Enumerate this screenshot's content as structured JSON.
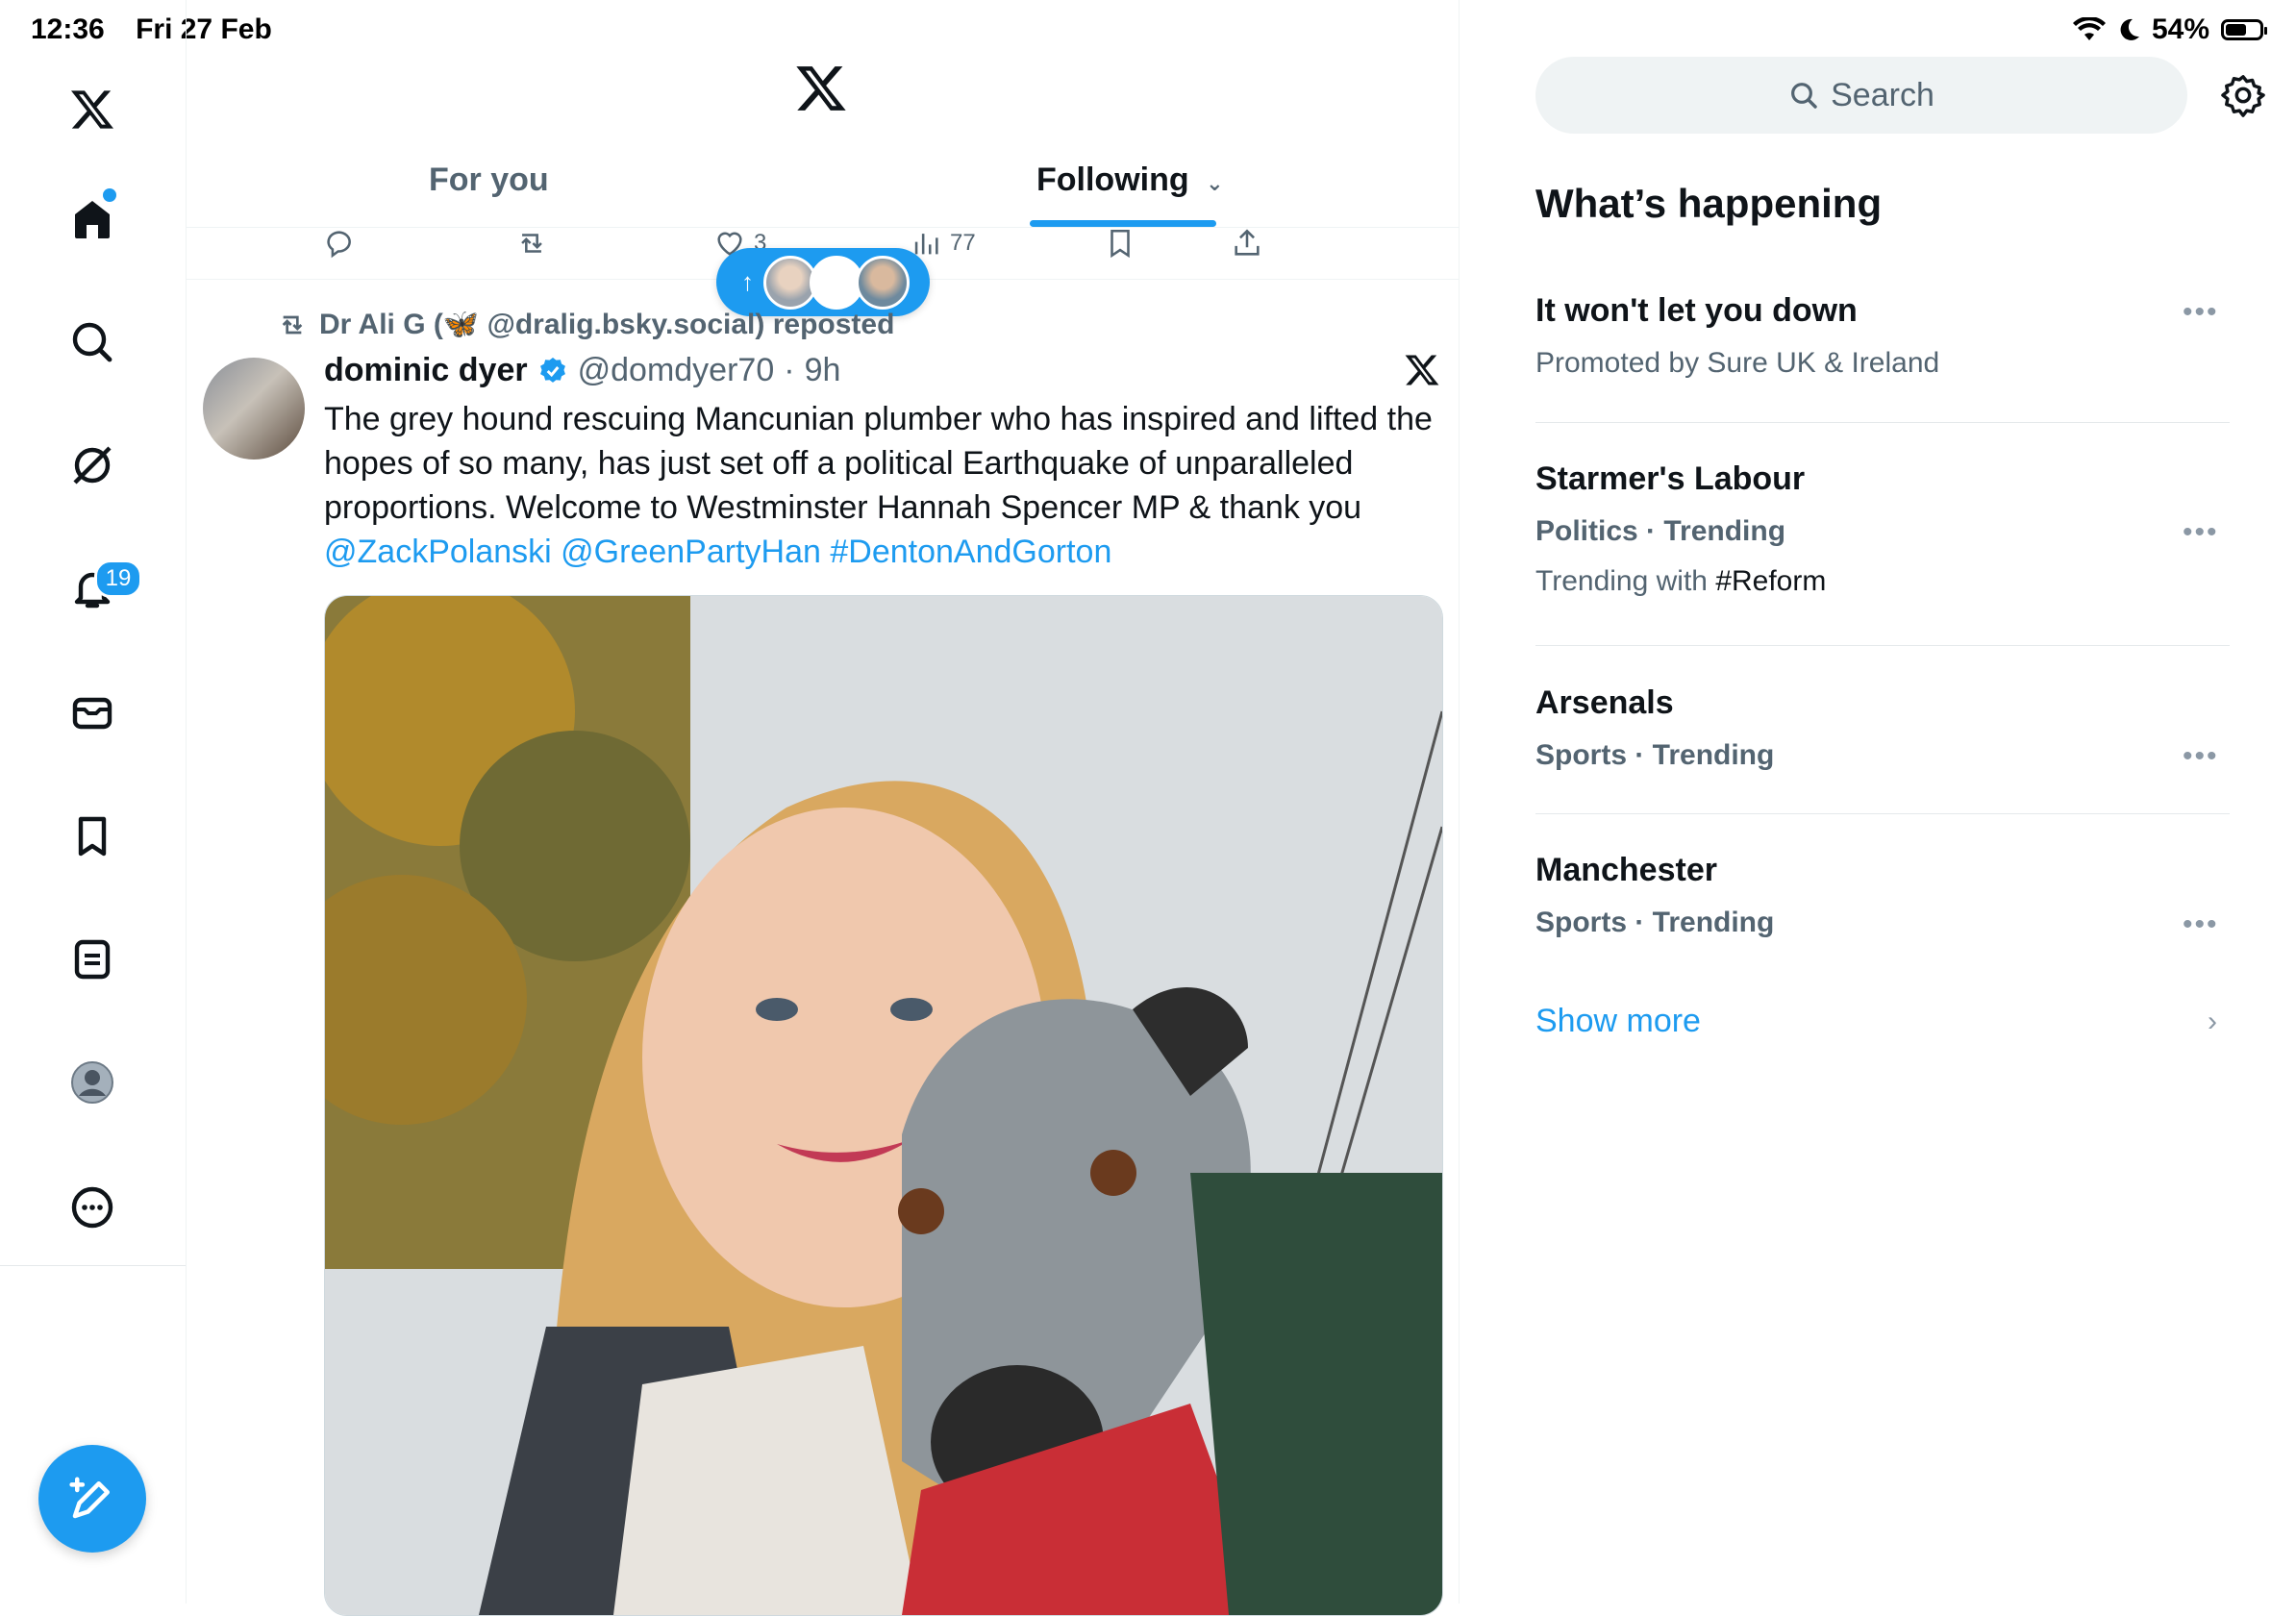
{
  "status_bar": {
    "time": "12:36",
    "date": "Fri 27 Feb",
    "battery": "54%"
  },
  "nav": {
    "items": [
      "home",
      "explore",
      "grok",
      "notifications",
      "messages",
      "bookmarks",
      "lists",
      "profile",
      "more"
    ],
    "notifications_badge": "19"
  },
  "tabs": {
    "for_you": "For you",
    "following": "Following"
  },
  "prev_tweet_actions": {
    "likes": "3",
    "views": "77"
  },
  "tweet": {
    "repost_by": "Dr Ali G (🦋 @dralig.bsky.social) reposted",
    "author_name": "dominic dyer",
    "handle": "@domdyer70",
    "separator": "·",
    "time": "9h",
    "text": "The grey hound rescuing Mancunian plumber who has inspired and lifted the hopes of so many, has just set off a political Earthquake of unparalleled proportions. Welcome to Westminster Hannah Spencer MP & thank you",
    "links": [
      "@ZackPolanski",
      "@GreenPartyHan",
      "#DentonAndGorton"
    ]
  },
  "search": {
    "placeholder": "Search"
  },
  "whats_happening": {
    "title": "What’s happening",
    "trends": [
      {
        "title": "It won't let you down",
        "meta": "Promoted by Sure UK & Ireland"
      },
      {
        "title": "Starmer's Labour",
        "meta": "Politics · Trending",
        "extra_prefix": "Trending with ",
        "extra_tag": "#Reform"
      },
      {
        "title": "Arsenals",
        "meta": "Sports · Trending"
      },
      {
        "title": "Manchester",
        "meta": "Sports · Trending"
      }
    ],
    "show_more": "Show more"
  },
  "colors": {
    "accent": "#1d9bf0",
    "text": "#0f1419",
    "muted": "#536471"
  }
}
